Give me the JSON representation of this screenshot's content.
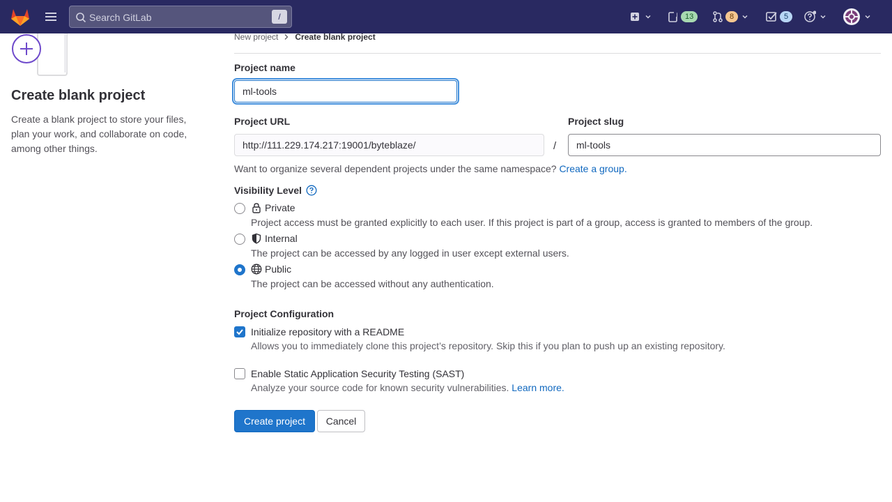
{
  "topbar": {
    "search_placeholder": "Search GitLab",
    "search_shortcut": "/",
    "issues_count": "13",
    "merge_requests_count": "8",
    "todos_count": "5"
  },
  "left_panel": {
    "title": "Create blank project",
    "description": "Create a blank project to store your files, plan your work, and collaborate on code, among other things."
  },
  "breadcrumb": {
    "parent": "New project",
    "current": "Create blank project"
  },
  "form": {
    "project_name_label": "Project name",
    "project_name_value": "ml-tools",
    "project_url_label": "Project URL",
    "project_url_value": "http://111.229.174.217:19001/byteblaze/",
    "url_separator": "/",
    "project_slug_label": "Project slug",
    "project_slug_value": "ml-tools",
    "namespace_help": "Want to organize several dependent projects under the same namespace?",
    "create_group_link": "Create a group.",
    "visibility_label": "Visibility Level",
    "visibility_options": [
      {
        "label": "Private",
        "description": "Project access must be granted explicitly to each user. If this project is part of a group, access is granted to members of the group.",
        "selected": false
      },
      {
        "label": "Internal",
        "description": "The project can be accessed by any logged in user except external users.",
        "selected": false
      },
      {
        "label": "Public",
        "description": "The project can be accessed without any authentication.",
        "selected": true
      }
    ],
    "config_label": "Project Configuration",
    "readme_label": "Initialize repository with a README",
    "readme_desc": "Allows you to immediately clone this project’s repository. Skip this if you plan to push up an existing repository.",
    "readme_checked": true,
    "sast_label": "Enable Static Application Security Testing (SAST)",
    "sast_desc": "Analyze your source code for known security vulnerabilities.",
    "sast_link": "Learn more.",
    "sast_checked": false,
    "create_button": "Create project",
    "cancel_button": "Cancel"
  },
  "colors": {
    "topbar_bg": "#292961",
    "primary": "#1f75cb",
    "link": "#1068bf"
  }
}
